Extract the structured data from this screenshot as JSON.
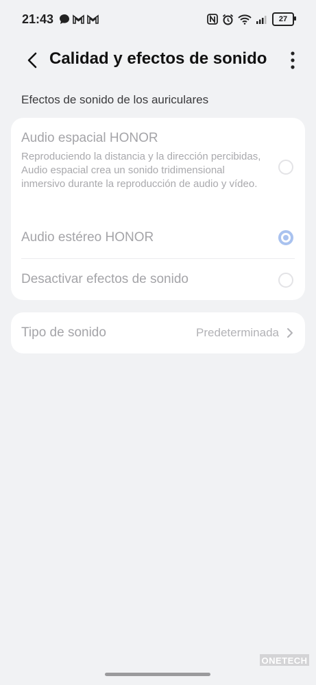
{
  "status_bar": {
    "time": "21:43",
    "battery": "27",
    "left_icons": [
      "chat-bubble-icon",
      "gmail-icon",
      "gmail-icon"
    ],
    "right_icons": [
      "nfc-icon",
      "alarm-icon",
      "wifi-icon",
      "signal-icon",
      "battery-icon"
    ]
  },
  "app_bar": {
    "title": "Calidad y efectos de sonido",
    "back_icon": "back-arrow-icon",
    "more_icon": "more-vert-icon"
  },
  "section": {
    "label": "Efectos de sonido de los auriculares"
  },
  "options": [
    {
      "title": "Audio espacial HONOR",
      "description": "Reproduciendo la distancia y la dirección percibidas, Audio espacial crea un sonido tridimensional inmersivo durante la reproducción de audio y vídeo.",
      "selected": false
    },
    {
      "title": "Audio estéreo HONOR",
      "description": "",
      "selected": true
    },
    {
      "title": "Desactivar efectos de sonido",
      "description": "",
      "selected": false
    }
  ],
  "sound_type": {
    "label": "Tipo de sonido",
    "value": "Predeterminada"
  },
  "watermark": "ONETECH",
  "colors": {
    "background": "#f1f2f4",
    "card": "#ffffff",
    "radio_selected": "#a9c2ef",
    "disabled_text": "#a4a4a8"
  }
}
